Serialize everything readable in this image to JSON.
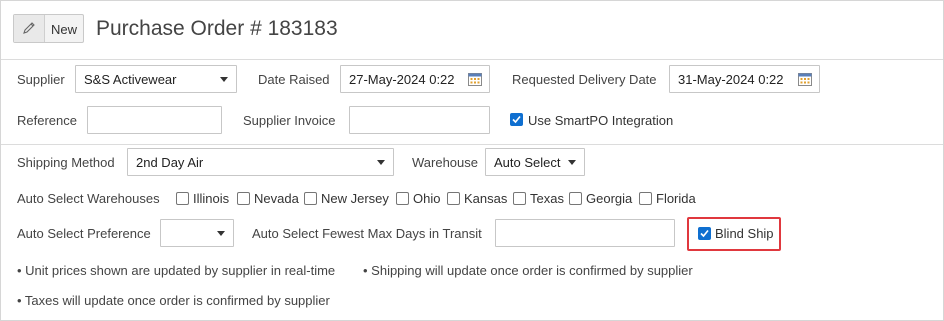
{
  "header": {
    "new_label": "New",
    "title": "Purchase Order # 183183"
  },
  "supplier": {
    "label": "Supplier",
    "value": "S&S Activewear"
  },
  "date_raised": {
    "label": "Date Raised",
    "value": "27-May-2024 0:22"
  },
  "requested_delivery": {
    "label": "Requested Delivery Date",
    "value": "31-May-2024 0:22"
  },
  "reference": {
    "label": "Reference",
    "value": ""
  },
  "supplier_invoice": {
    "label": "Supplier Invoice",
    "value": ""
  },
  "smartpo": {
    "label": "Use SmartPO Integration",
    "checked": true
  },
  "shipping_method": {
    "label": "Shipping Method",
    "value": "2nd Day Air"
  },
  "warehouse": {
    "label": "Warehouse",
    "value": "Auto Select"
  },
  "auto_select_warehouses": {
    "label": "Auto Select Warehouses",
    "options": [
      "Illinois",
      "Nevada",
      "New Jersey",
      "Ohio",
      "Kansas",
      "Texas",
      "Georgia",
      "Florida"
    ]
  },
  "auto_select_preference": {
    "label": "Auto Select Preference",
    "value": ""
  },
  "fewest_max_days": {
    "label": "Auto Select Fewest Max Days in Transit",
    "value": ""
  },
  "blind_ship": {
    "label": "Blind Ship",
    "checked": true
  },
  "notes": [
    "• Unit prices shown are updated by supplier in real-time",
    "• Shipping will update once order is confirmed by supplier",
    "• Taxes will update once order is confirmed by supplier"
  ],
  "colors": {
    "accent": "#0f6fd0",
    "highlight": "#e0383e"
  },
  "icons": {
    "edit": "pencil-icon",
    "date": "calendar-icon",
    "dropdown": "caret-down-icon"
  }
}
